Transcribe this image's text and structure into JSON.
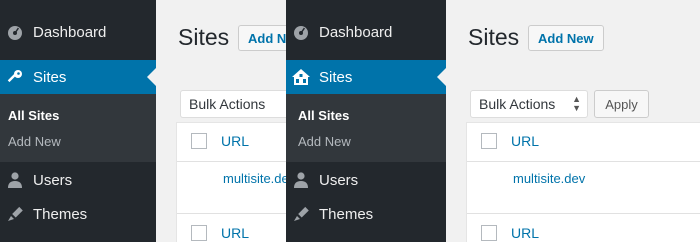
{
  "left": {
    "menu": {
      "dashboard": "Dashboard",
      "sites": "Sites",
      "users": "Users",
      "themes": "Themes"
    },
    "submenu": {
      "all_sites": "All Sites",
      "add_new": "Add New"
    },
    "main": {
      "title": "Sites",
      "add_new_button": "Add N",
      "bulk_actions": "Bulk Actions",
      "column_url": "URL",
      "site_url": "multisite.de",
      "column_url_footer": "URL"
    },
    "icons": {
      "dashboard": "dashboard-icon",
      "sites": "key-icon",
      "users": "user-icon",
      "themes": "brush-icon"
    }
  },
  "right": {
    "menu": {
      "dashboard": "Dashboard",
      "sites": "Sites",
      "users": "Users",
      "themes": "Themes"
    },
    "submenu": {
      "all_sites": "All Sites",
      "add_new": "Add New"
    },
    "main": {
      "title": "Sites",
      "add_new_button": "Add New",
      "bulk_actions": "Bulk Actions",
      "apply_button": "Apply",
      "column_url": "URL",
      "site_url": "multisite.dev",
      "column_url_footer": "URL"
    },
    "icons": {
      "dashboard": "dashboard-icon",
      "sites": "network-house-icon",
      "users": "user-icon",
      "themes": "brush-icon"
    }
  },
  "colors": {
    "sidebar": "#23282d",
    "active": "#0073aa",
    "submenu": "#32373c",
    "link": "#0073aa"
  }
}
